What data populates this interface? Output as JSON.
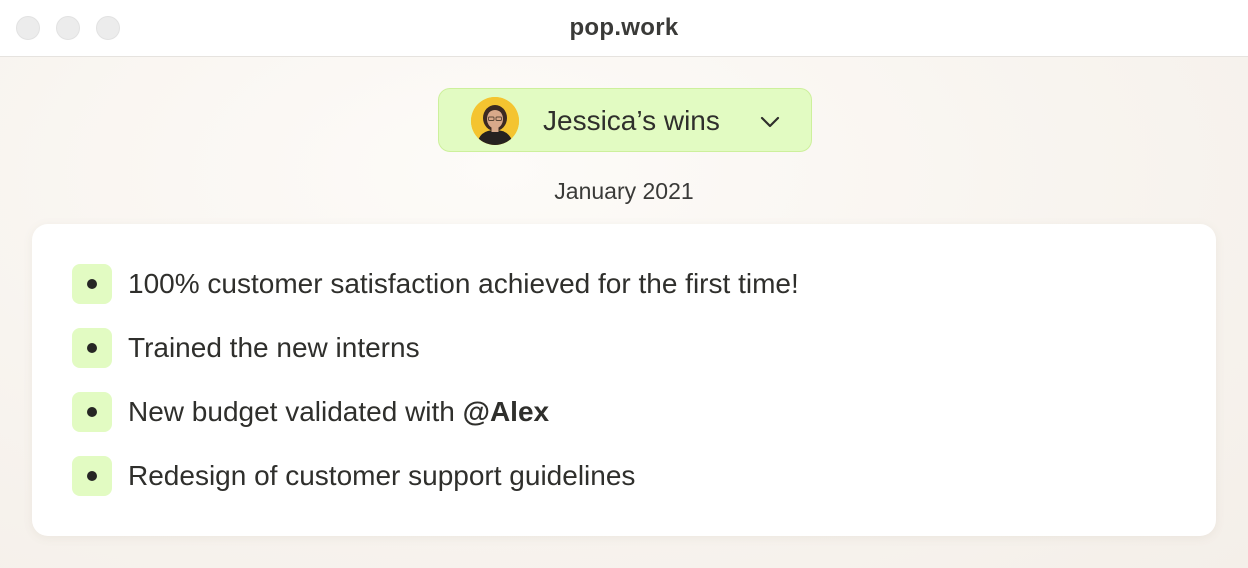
{
  "window": {
    "title": "pop.work"
  },
  "selector": {
    "label": "Jessica’s wins",
    "avatar_icon": "person-avatar-icon",
    "dropdown_icon": "chevron-down-icon"
  },
  "period": "January 2021",
  "wins": [
    {
      "text": "100% customer satisfaction achieved for the first time!",
      "mention": ""
    },
    {
      "text": "Trained the new interns",
      "mention": ""
    },
    {
      "text": "New budget validated with ",
      "mention": "@Alex"
    },
    {
      "text": "Redesign of customer support guidelines",
      "mention": ""
    }
  ],
  "colors": {
    "accent_fill": "#e2fbc2",
    "accent_border": "#cdf09c",
    "text": "#2f2f2c",
    "avatar_background": "#f4c430"
  }
}
